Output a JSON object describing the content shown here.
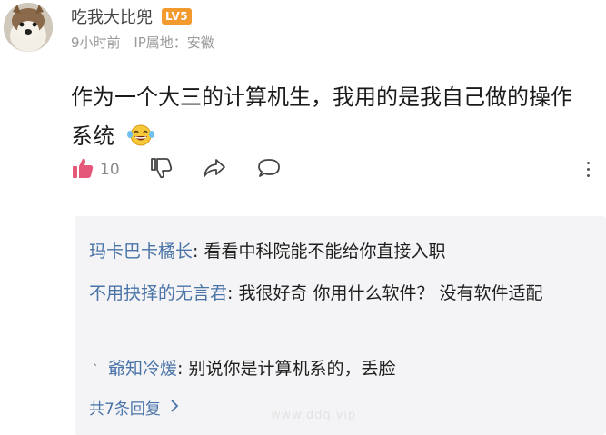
{
  "post": {
    "author": "吃我大比兜",
    "level": "LV5",
    "time": "9小时前",
    "ip_location": "IP属地：安徽",
    "content": "作为一个大三的计算机生，我用的是我自己做的操作系统",
    "emoji": "laughing-tears-icon",
    "like_count": "10"
  },
  "replies": [
    {
      "user": "玛卡巴卡橘长",
      "text": ": 看看中科院能不能给你直接入职"
    },
    {
      "user": "不用抉择的无言君",
      "text": ": 我很好奇 你用什么软件？ 没有软件适配"
    },
    {
      "user": "爺知冷煖",
      "text": ": 别说你是计算机系的，丢脸"
    }
  ],
  "more_replies_label": "共7条回复",
  "watermark": "www.ddq.vip",
  "colors": {
    "like_accent": "#e5587a",
    "link_blue": "#4a74a8",
    "level_badge": "#f29a2e",
    "reply_background": "#f4f4f6"
  }
}
